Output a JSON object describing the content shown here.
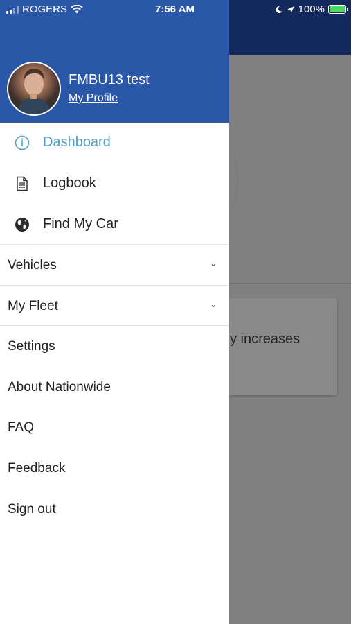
{
  "status_bar": {
    "carrier": "ROGERS",
    "time": "7:56 AM",
    "battery": "100%",
    "icons": [
      "signal-icon",
      "wifi-icon",
      "moon-icon",
      "location-arrow-icon",
      "battery-charging-icon"
    ]
  },
  "drawer": {
    "user_name": "FMBU13 test",
    "profile_link": "My Profile",
    "nav_items": [
      {
        "label": "Dashboard",
        "icon": "dashboard-gauge-icon",
        "active": true
      },
      {
        "label": "Logbook",
        "icon": "document-icon",
        "active": false
      },
      {
        "label": "Find My Car",
        "icon": "globe-icon",
        "active": false
      }
    ],
    "sections": [
      {
        "label": "Vehicles",
        "icon": "chevron-down-icon"
      },
      {
        "label": "My Fleet",
        "icon": "chevron-down-icon"
      }
    ],
    "links": [
      "Settings",
      "About Nationwide",
      "FAQ",
      "Feedback",
      "Sign out"
    ]
  },
  "background": {
    "card_text": "y increases"
  },
  "colors": {
    "header_blue": "#2b57a8",
    "active_blue": "#4f9ec8",
    "background_dim": "#808080"
  }
}
